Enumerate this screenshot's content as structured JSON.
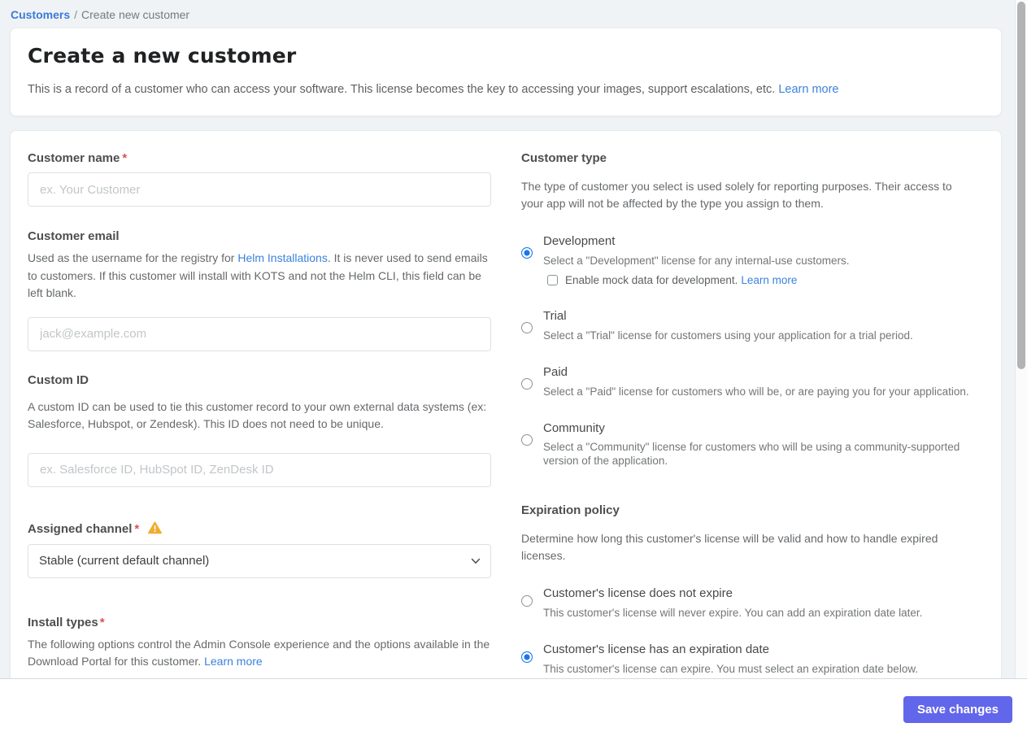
{
  "breadcrumb": {
    "link": "Customers",
    "separator": "/",
    "current": "Create new customer"
  },
  "header": {
    "title": "Create a new customer",
    "description": "This is a record of a customer who can access your software. This license becomes the key to accessing your images, support escalations, etc.",
    "learn_more": "Learn more"
  },
  "form": {
    "customer_name": {
      "label": "Customer name",
      "required": "*",
      "placeholder": "ex. Your Customer"
    },
    "customer_email": {
      "label": "Customer email",
      "text_before": "Used as the username for the registry for ",
      "link": "Helm Installations",
      "text_after": ". It is never used to send emails to customers. If this customer will install with KOTS and not the Helm CLI, this field can be left blank.",
      "placeholder": "jack@example.com"
    },
    "custom_id": {
      "label": "Custom ID",
      "description": "A custom ID can be used to tie this customer record to your own external data systems (ex: Salesforce, Hubspot, or Zendesk). This ID does not need to be unique.",
      "placeholder": "ex. Salesforce ID, HubSpot ID, ZenDesk ID"
    },
    "assigned_channel": {
      "label": "Assigned channel",
      "required": "*",
      "selected_option": "Stable (current default channel)"
    },
    "install_types": {
      "label": "Install types",
      "required": "*",
      "description": "The following options control the Admin Console experience and the options available in the Download Portal for this customer.",
      "learn_more": "Learn more"
    }
  },
  "customer_type": {
    "heading": "Customer type",
    "description": "The type of customer you select is used solely for reporting purposes. Their access to your app will not be affected by the type you assign to them.",
    "options": [
      {
        "label": "Development",
        "description": "Select a \"Development\" license for any internal-use customers.",
        "selected": true,
        "checkbox_label": "Enable mock data for development.",
        "checkbox_link": "Learn more",
        "checkbox_checked": false
      },
      {
        "label": "Trial",
        "description": "Select a \"Trial\" license for customers using your application for a trial period.",
        "selected": false
      },
      {
        "label": "Paid",
        "description": "Select a \"Paid\" license for customers who will be, or are paying you for your application.",
        "selected": false
      },
      {
        "label": "Community",
        "description": "Select a \"Community\" license for customers who will be using a community-supported version of the application.",
        "selected": false
      }
    ]
  },
  "expiration_policy": {
    "heading": "Expiration policy",
    "description": "Determine how long this customer's license will be valid and how to handle expired licenses.",
    "options": [
      {
        "label": "Customer's license does not expire",
        "description": "This customer's license will never expire. You can add an expiration date later.",
        "selected": false
      },
      {
        "label": "Customer's license has an expiration date",
        "description": "This customer's license can expire. You must select an expiration date below.",
        "selected": true
      }
    ]
  },
  "footer": {
    "save_button": "Save changes"
  },
  "colors": {
    "accent_button": "#6266ea",
    "link_blue": "#3b82dc",
    "radio_selected": "#1b76ec",
    "required_red": "#d9534f",
    "warning_orange": "#f0ad2d",
    "page_background": "#f0f3f5"
  }
}
